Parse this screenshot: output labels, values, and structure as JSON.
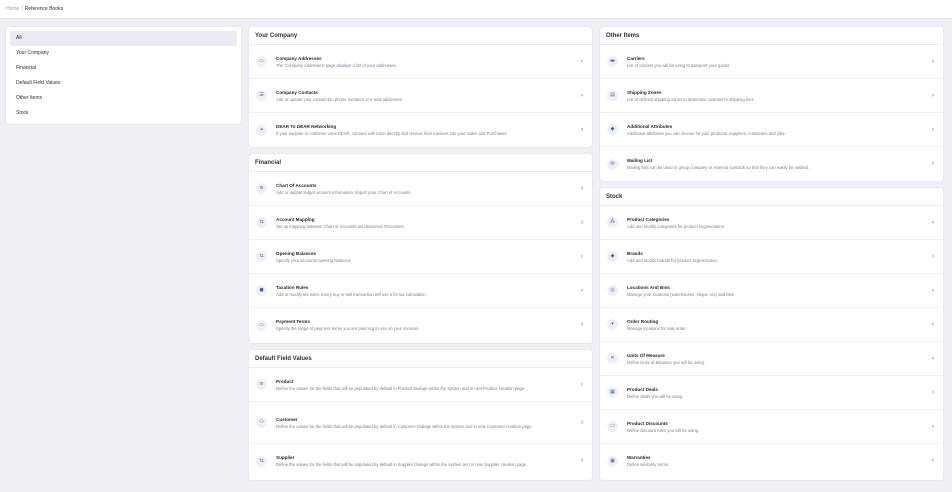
{
  "breadcrumb": {
    "home": "Home",
    "separator": "/",
    "current": "Reference Books"
  },
  "nav": {
    "items": [
      {
        "label": "All",
        "active": true
      },
      {
        "label": "Your Company",
        "active": false
      },
      {
        "label": "Financial",
        "active": false
      },
      {
        "label": "Default Field Values",
        "active": false
      },
      {
        "label": "Other Items",
        "active": false
      },
      {
        "label": "Stock",
        "active": false
      }
    ]
  },
  "your_company": {
    "title": "Your Company",
    "items": [
      {
        "title": "Company Addresses",
        "desc": "The 'Company Addresses' page displays a list of your addresses.",
        "icon": "map-icon"
      },
      {
        "title": "Company Contacts",
        "desc": "Add or update your contact list, phone numbers or e-mail addresses",
        "icon": "contacts-icon"
      },
      {
        "title": "DEAR To DEAR Networking",
        "desc": "If your supplier or customer uses DEAR, connect with them directly and receive their invoices into your Sales and Purchases.",
        "icon": "network-icon"
      }
    ]
  },
  "financial": {
    "title": "Financial",
    "items": [
      {
        "title": "Chart Of Accounts",
        "desc": "Add or update ledger account information. Import your Chart of Accounts",
        "icon": "list-icon"
      },
      {
        "title": "Account Mapping",
        "desc": "Set up mapping between Chart of Accounts and Business Processes.",
        "icon": "mapping-icon"
      },
      {
        "title": "Opening Balances",
        "desc": "Specify your accounts opening balances",
        "icon": "balance-icon"
      },
      {
        "title": "Taxation Rules",
        "desc": "Add or modify tax rules. Every buy or sell transaction will use it for tax calculation",
        "icon": "tax-icon"
      },
      {
        "title": "Payment Terms",
        "desc": "Specify the range of payment terms you are planning to use on your invoices.",
        "icon": "payment-icon"
      }
    ]
  },
  "default_fields": {
    "title": "Default Field Values",
    "items": [
      {
        "title": "Product",
        "desc": "Define the values for the fields that will be populated by default in Product Dialogs within the system and in new Product creation page.",
        "icon": "product-icon"
      },
      {
        "title": "Customer",
        "desc": "Define the values for the fields that will be populated by default in Customer Dialogs within the system and in new Customer creation page.",
        "icon": "customer-icon"
      },
      {
        "title": "Supplier",
        "desc": "Define the values for the fields that will be populated by default in Supplier Dialogs within the system and in new Supplier creation page.",
        "icon": "supplier-icon"
      }
    ]
  },
  "other_items": {
    "title": "Other Items",
    "items": [
      {
        "title": "Carriers",
        "desc": "List of carriers you will be using to transport your goods",
        "icon": "truck-icon"
      },
      {
        "title": "Shipping Zones",
        "desc": "List of defined shipping zones to determine customer's shipping fees",
        "icon": "shipping-zone-icon"
      },
      {
        "title": "Additional Attributes",
        "desc": "Additional attributes you can choose for your products, suppliers, customers and jobs.",
        "icon": "attributes-icon"
      },
      {
        "title": "Mailing List",
        "desc": "Mailing lists can be used to group company or external contacts so that they can easily be notified.",
        "icon": "mail-icon"
      }
    ]
  },
  "stock": {
    "title": "Stock",
    "items": [
      {
        "title": "Product Categories",
        "desc": "Add and modify categories for product segmentation",
        "icon": "categories-icon"
      },
      {
        "title": "Brands",
        "desc": "Add and modify brands for product segmentation",
        "icon": "tag-icon"
      },
      {
        "title": "Locations And Bins",
        "desc": "Manage your locations (warehouses, shops, etc) and bins",
        "icon": "location-icon"
      },
      {
        "title": "Order Routing",
        "desc": "Manage locations for sale order",
        "icon": "cart-icon"
      },
      {
        "title": "Units Of Measure",
        "desc": "Define Units of Measure you will be using.",
        "icon": "measure-icon"
      },
      {
        "title": "Product Deals",
        "desc": "Define deals you will be using.",
        "icon": "deals-icon"
      },
      {
        "title": "Product Discounts",
        "desc": "Define discount rules you will be using.",
        "icon": "discount-icon"
      },
      {
        "title": "Warranties",
        "desc": "Define warranty terms.",
        "icon": "warranty-icon"
      }
    ]
  },
  "chevron": "›",
  "colors": {
    "icon_bg": "#edf0f8",
    "icon_fg": "#4b5d92",
    "active_nav": "#e9edf3",
    "page_bg": "#eef0f3"
  }
}
